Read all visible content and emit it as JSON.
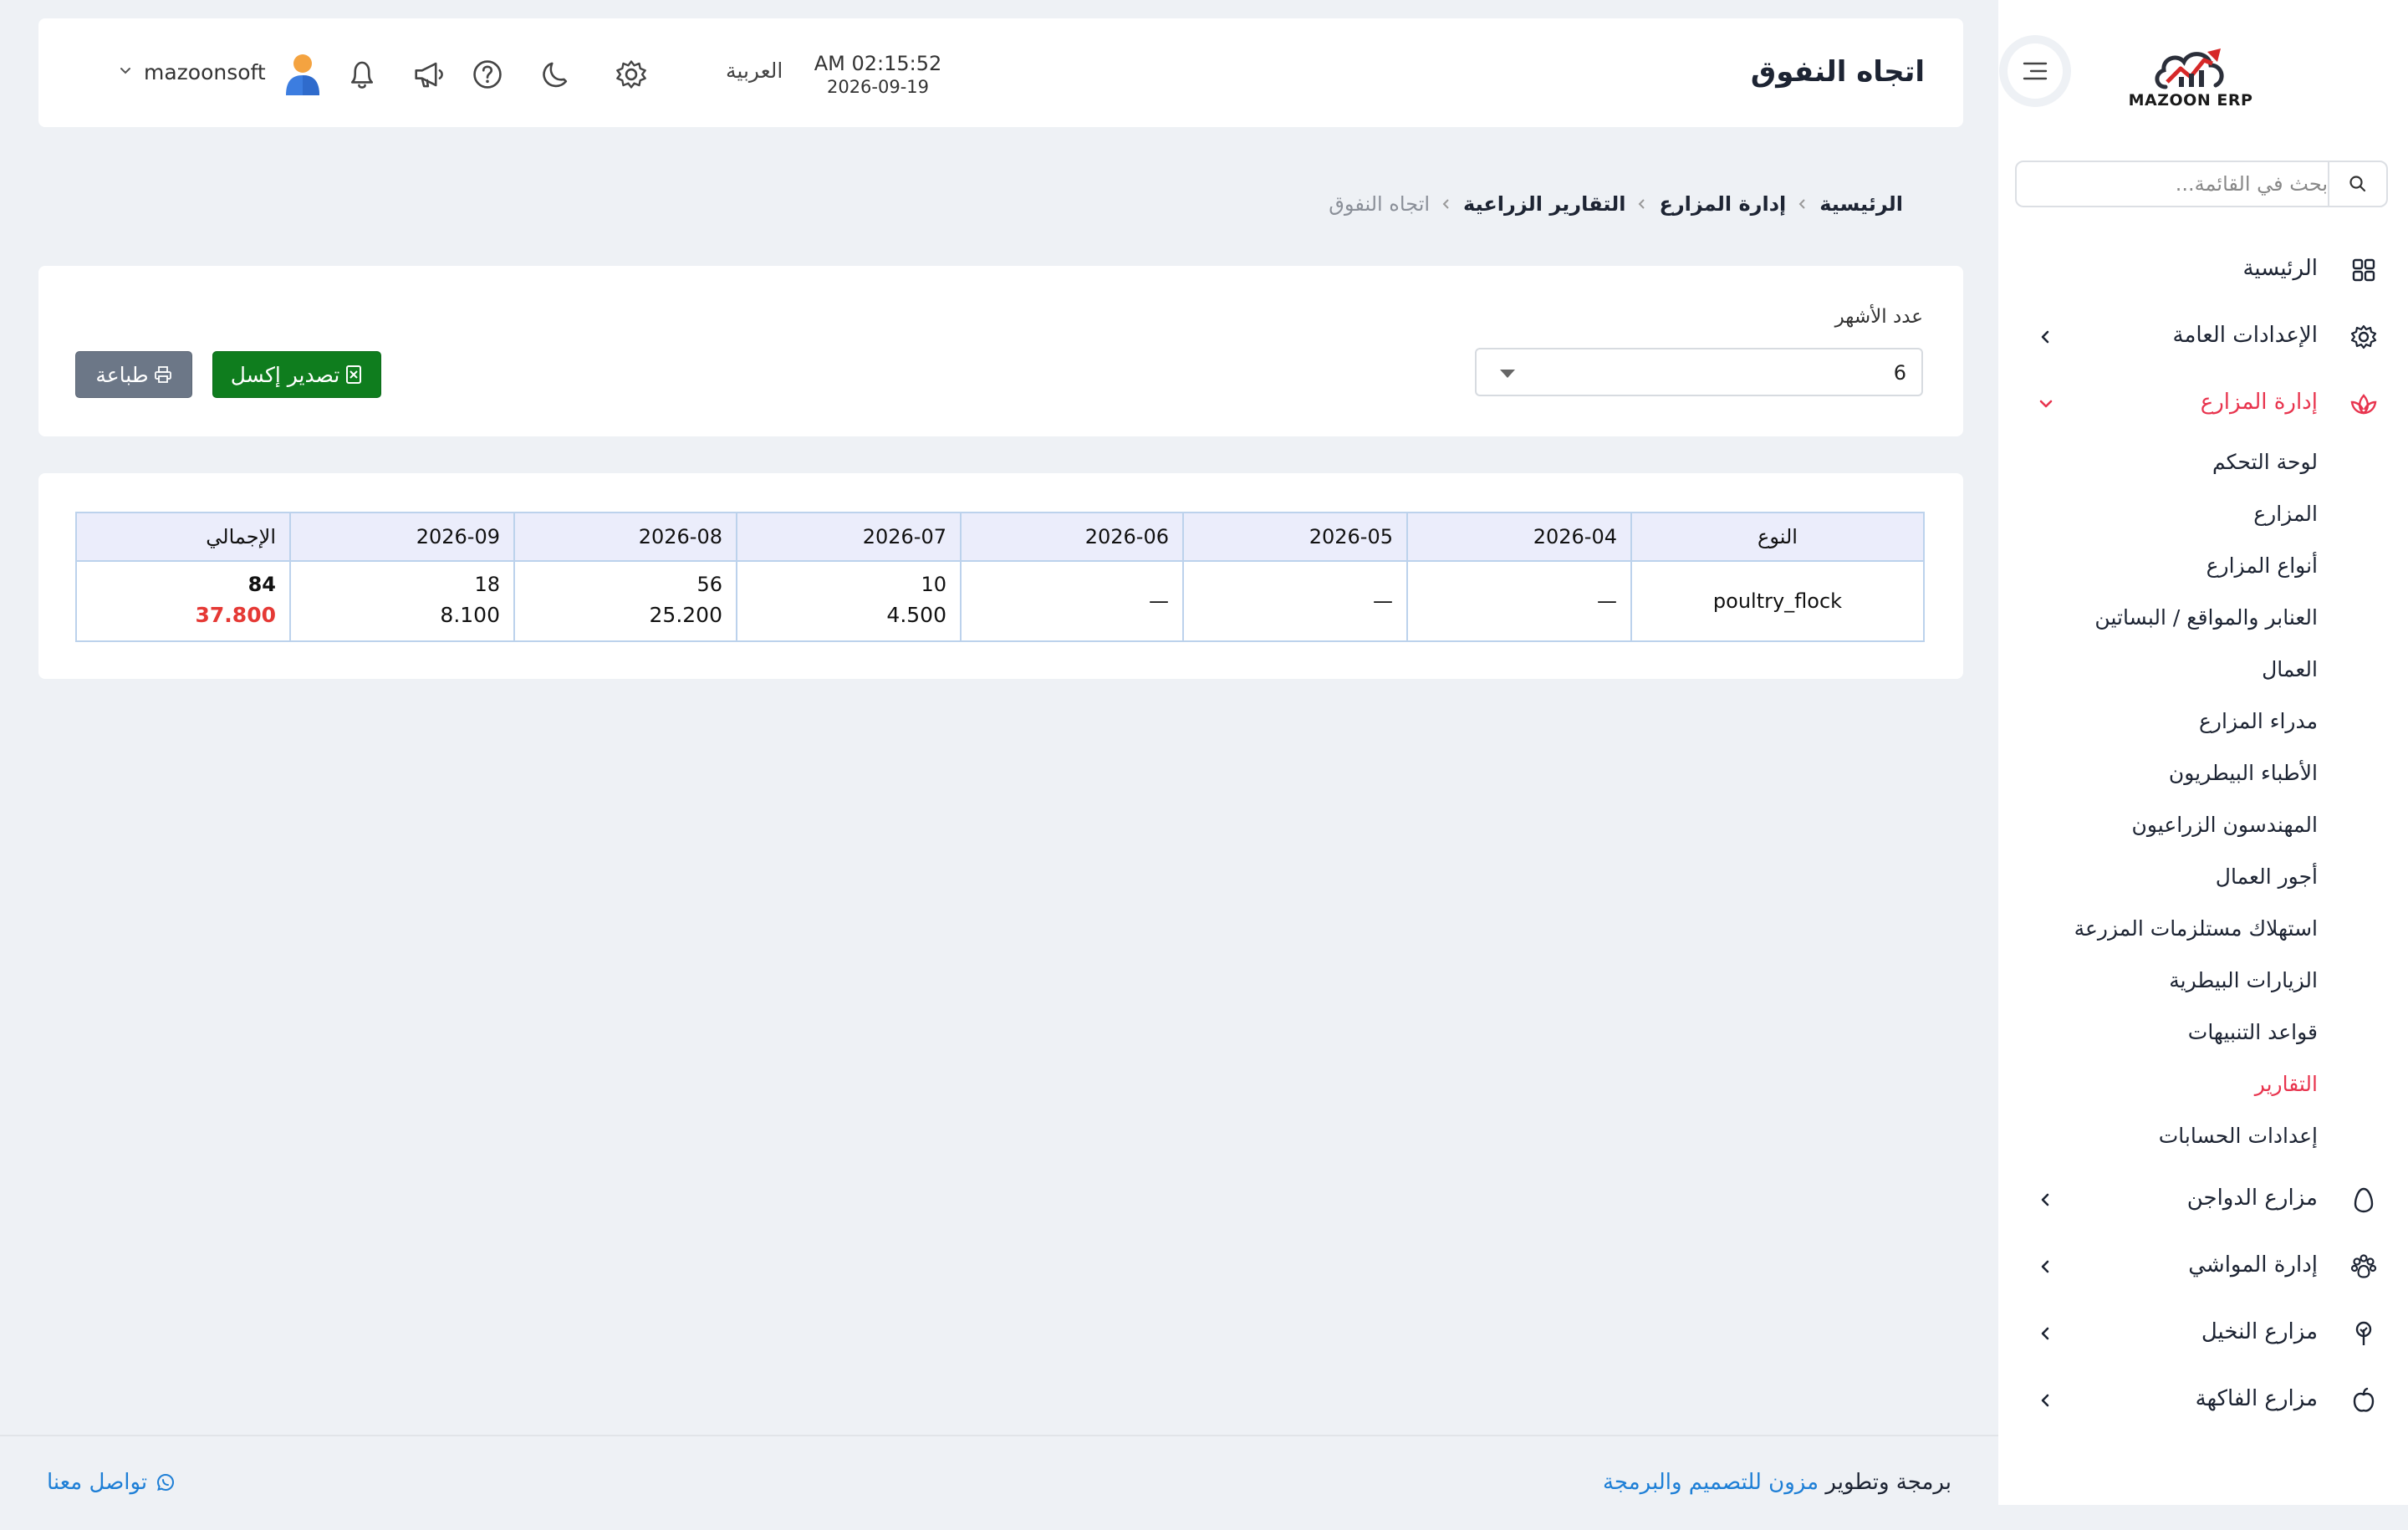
{
  "sidebar": {
    "logo_text": "MAZOON ERP",
    "search_placeholder": "بحث في القائمة...",
    "items": [
      {
        "label": "الرئيسية",
        "icon": "grid-icon"
      },
      {
        "label": "الإعدادات العامة",
        "icon": "gear-icon"
      },
      {
        "label": "إدارة المزارع",
        "icon": "lotus-icon",
        "expanded": true
      },
      {
        "label": "مزارع الدواجن",
        "icon": "egg-icon"
      },
      {
        "label": "إدارة المواشي",
        "icon": "paw-icon"
      },
      {
        "label": "مزارع النخيل",
        "icon": "tree-icon"
      },
      {
        "label": "مزارع الفاكهة",
        "icon": "apple-icon"
      }
    ],
    "sub_items": [
      "لوحة التحكم",
      "المزارع",
      "أنواع المزارع",
      "العنابر والمواقع / البساتين",
      "العمال",
      "مدراء المزارع",
      "الأطباء البيطريون",
      "المهندسون الزراعيون",
      "أجور العمال",
      "استهلاك مستلزمات المزرعة",
      "الزيارات البيطرية",
      "قواعد التنبيهات",
      "التقارير",
      "إعدادات الحسابات"
    ],
    "active_sub_item": "التقارير"
  },
  "header": {
    "title": "اتجاه النفوق",
    "time": "AM 02:15:52",
    "date": "2026-09-19",
    "language": "العربية",
    "username": "mazoonsoft"
  },
  "breadcrumb": [
    "الرئيسية",
    "إدارة المزارع",
    "التقارير الزراعية",
    "اتجاه النفوق"
  ],
  "filters": {
    "months_label": "عدد الأشهر",
    "months_value": "6",
    "export_excel_label": "تصدير إكسل",
    "print_label": "طباعة"
  },
  "table": {
    "headers": [
      "النوع",
      "2026-04",
      "2026-05",
      "2026-06",
      "2026-07",
      "2026-08",
      "2026-09",
      "الإجمالي"
    ],
    "rows": [
      {
        "type": "poultry_flock",
        "cells": [
          {
            "count": "—",
            "amount": ""
          },
          {
            "count": "—",
            "amount": ""
          },
          {
            "count": "—",
            "amount": ""
          },
          {
            "count": "10",
            "amount": "4.500"
          },
          {
            "count": "56",
            "amount": "25.200"
          },
          {
            "count": "18",
            "amount": "8.100"
          }
        ],
        "total": {
          "count": "84",
          "amount": "37.800"
        }
      }
    ]
  },
  "footer": {
    "credit_prefix": "برمجة وتطوير",
    "credit_link": "مزون للتصميم والبرمجة",
    "contact_label": "تواصل معنا"
  },
  "colors": {
    "accent": "#e8344e",
    "excel_green": "#0f7d1e",
    "print_gray": "#6c7787",
    "link_blue": "#1e7fd6",
    "total_red": "#e53935"
  }
}
